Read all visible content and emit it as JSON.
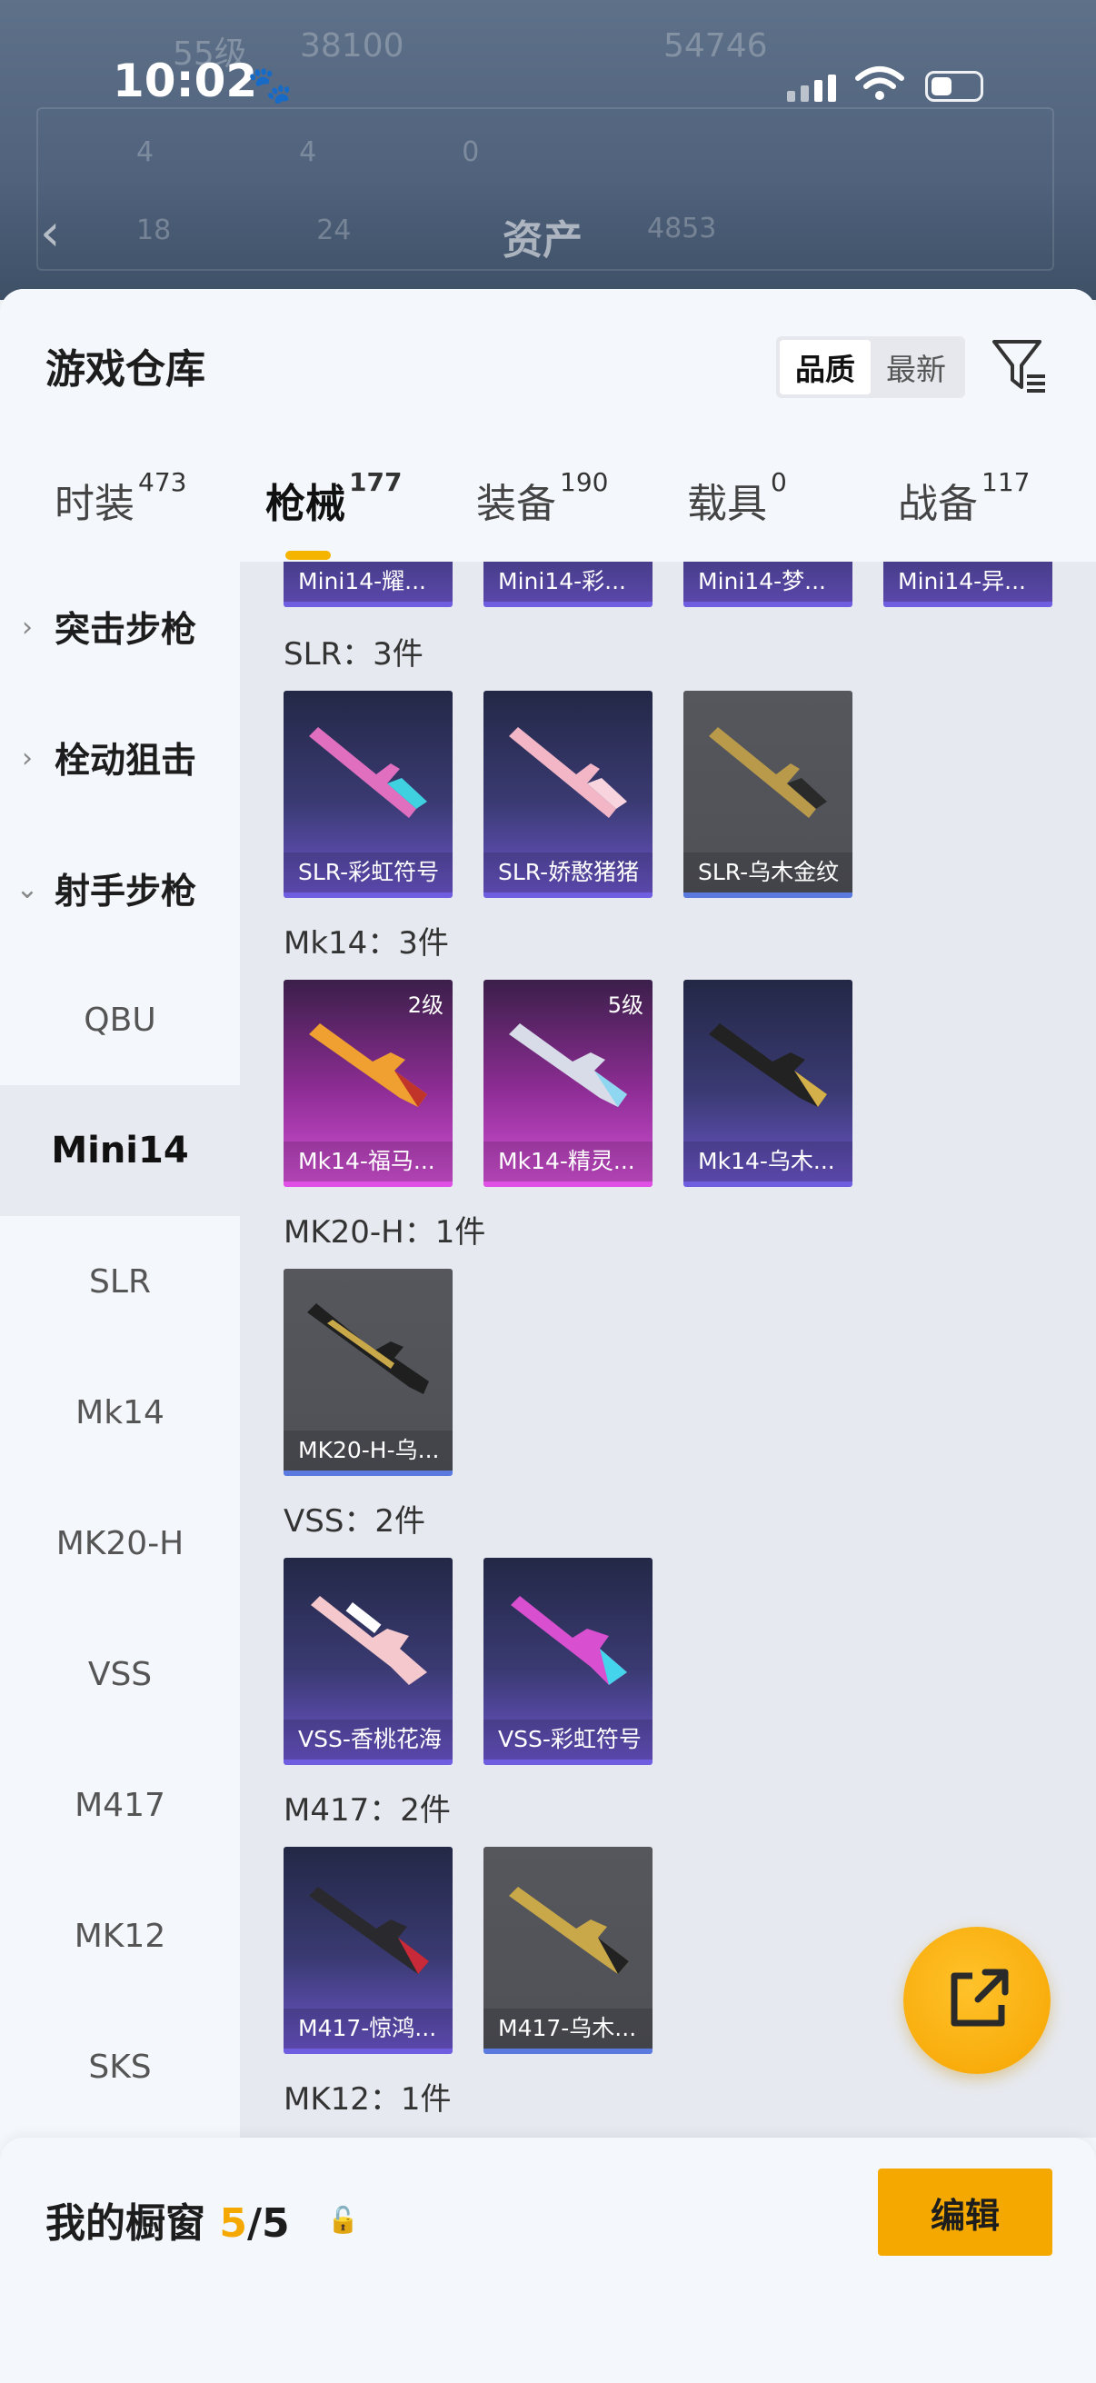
{
  "status_bar": {
    "time": "10:02"
  },
  "background": {
    "ghost_text_1": "55级",
    "ghost_text_2": "38100",
    "ghost_text_3": "54746",
    "stats_row1": [
      "4",
      "4",
      "0"
    ],
    "stats_row2": [
      "18",
      "24",
      "4853"
    ],
    "asset_label": "资产"
  },
  "header": {
    "title": "游戏仓库",
    "sort_options": [
      "品质",
      "最新"
    ],
    "sort_selected": "品质"
  },
  "tabs": [
    {
      "label": "时装",
      "count": "473"
    },
    {
      "label": "枪械",
      "count": "177"
    },
    {
      "label": "装备",
      "count": "190"
    },
    {
      "label": "载具",
      "count": "0"
    },
    {
      "label": "战备",
      "count": "117"
    }
  ],
  "sidebar": {
    "groups": [
      {
        "label": "突击步枪"
      },
      {
        "label": "栓动狙击"
      },
      {
        "label": "射手步枪"
      }
    ],
    "items": [
      "QBU",
      "Mini14",
      "SLR",
      "Mk14",
      "MK20-H",
      "VSS",
      "M417",
      "MK12",
      "SKS"
    ],
    "selected": "Mini14"
  },
  "content": {
    "top_partial": [
      "Mini14-耀...",
      "Mini14-彩...",
      "Mini14-梦...",
      "Mini14-异..."
    ],
    "sections": [
      {
        "header": "SLR：3件",
        "cards": [
          {
            "name": "SLR-彩虹符号",
            "level": ""
          },
          {
            "name": "SLR-娇憨猪猪",
            "level": ""
          },
          {
            "name": "SLR-乌木金纹",
            "level": ""
          }
        ]
      },
      {
        "header": "Mk14：3件",
        "cards": [
          {
            "name": "Mk14-福马...",
            "level": "2级"
          },
          {
            "name": "Mk14-精灵...",
            "level": "5级"
          },
          {
            "name": "Mk14-乌木...",
            "level": ""
          }
        ]
      },
      {
        "header": "MK20-H：1件",
        "cards": [
          {
            "name": "MK20-H-乌...",
            "level": ""
          }
        ]
      },
      {
        "header": "VSS：2件",
        "cards": [
          {
            "name": "VSS-香桃花海",
            "level": ""
          },
          {
            "name": "VSS-彩虹符号",
            "level": ""
          }
        ]
      },
      {
        "header": "M417：2件",
        "cards": [
          {
            "name": "M417-惊鸿...",
            "level": ""
          },
          {
            "name": "M417-乌木...",
            "level": ""
          }
        ]
      },
      {
        "header": "MK12：1件",
        "cards": []
      }
    ]
  },
  "showcase": {
    "label": "我的橱窗",
    "current": "5",
    "separator": "/",
    "total": "5",
    "edit_label": "编辑"
  },
  "colors": {
    "accent": "#f5a800",
    "purple_card": "#6f5fe0",
    "pink_card": "#e04fe6"
  }
}
